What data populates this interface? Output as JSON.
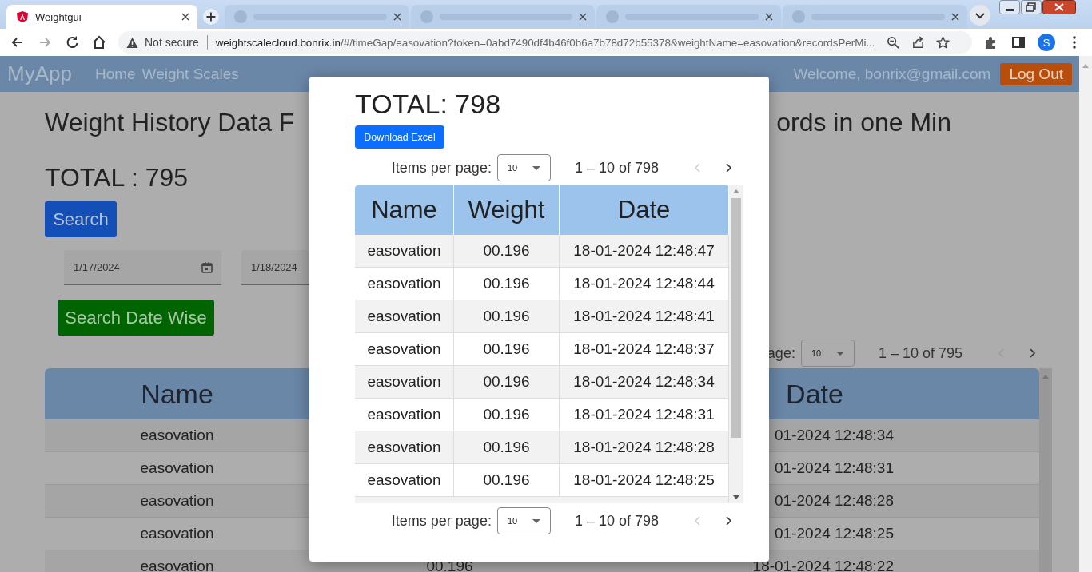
{
  "browser": {
    "tabs": [
      {
        "title": "Weightgui",
        "selected": true
      },
      {
        "selected": false
      },
      {
        "selected": false
      },
      {
        "selected": false
      },
      {
        "selected": false
      }
    ],
    "address_bar": {
      "security": "Not secure",
      "host": "weightscalecloud.bonrix.in",
      "path": "/#/timeGap/easovation?token=0abd7490df4b46f0b6a7b78d72b55378&weightName=easovation&recordsPerMi...",
      "profile": "S"
    }
  },
  "navbar": {
    "brand": "MyApp",
    "links": [
      "Home",
      "Weight Scales"
    ],
    "welcome": "Welcome, bonrix@gmail.com",
    "logout": "Log Out"
  },
  "page": {
    "heading_left": "Weight History Data F",
    "heading_right": "ords in one Min",
    "total": "TOTAL : 795",
    "search_button": "Search",
    "date_from": "1/17/2024",
    "date_to": "1/18/2024",
    "date_search_button": "Search Date Wise",
    "paginator": {
      "label": "age:",
      "page_size": "10",
      "range": "1 – 10 of 795",
      "prev_disabled": true
    },
    "table": {
      "columns": [
        "Name",
        "Date"
      ],
      "rows": [
        {
          "name": "easovation",
          "date": "01-2024 12:48:34"
        },
        {
          "name": "easovation",
          "date": "01-2024 12:48:31"
        },
        {
          "name": "easovation",
          "date": "01-2024 12:48:28"
        },
        {
          "name": "easovation",
          "date": "01-2024 12:48:25"
        },
        {
          "name": "easovation",
          "weight": "00.196",
          "date": "18-01-2024 12:48:22"
        }
      ]
    }
  },
  "dialog": {
    "total": "TOTAL: 798",
    "download_button": "Download Excel",
    "top_paginator": {
      "label": "Items per page:",
      "page_size": "10",
      "range": "1 – 10 of 798",
      "prev_disabled": true
    },
    "table": {
      "columns": [
        "Name",
        "Weight",
        "Date"
      ],
      "rows": [
        {
          "name": "easovation",
          "weight": "00.196",
          "date": "18-01-2024 12:48:47"
        },
        {
          "name": "easovation",
          "weight": "00.196",
          "date": "18-01-2024 12:48:44"
        },
        {
          "name": "easovation",
          "weight": "00.196",
          "date": "18-01-2024 12:48:41"
        },
        {
          "name": "easovation",
          "weight": "00.196",
          "date": "18-01-2024 12:48:37"
        },
        {
          "name": "easovation",
          "weight": "00.196",
          "date": "18-01-2024 12:48:34"
        },
        {
          "name": "easovation",
          "weight": "00.196",
          "date": "18-01-2024 12:48:31"
        },
        {
          "name": "easovation",
          "weight": "00.196",
          "date": "18-01-2024 12:48:28"
        },
        {
          "name": "easovation",
          "weight": "00.196",
          "date": "18-01-2024 12:48:25"
        }
      ]
    },
    "bottom_paginator": {
      "label": "Items per page:",
      "page_size": "10",
      "range": "1 – 10 of 798",
      "prev_disabled": true
    }
  }
}
